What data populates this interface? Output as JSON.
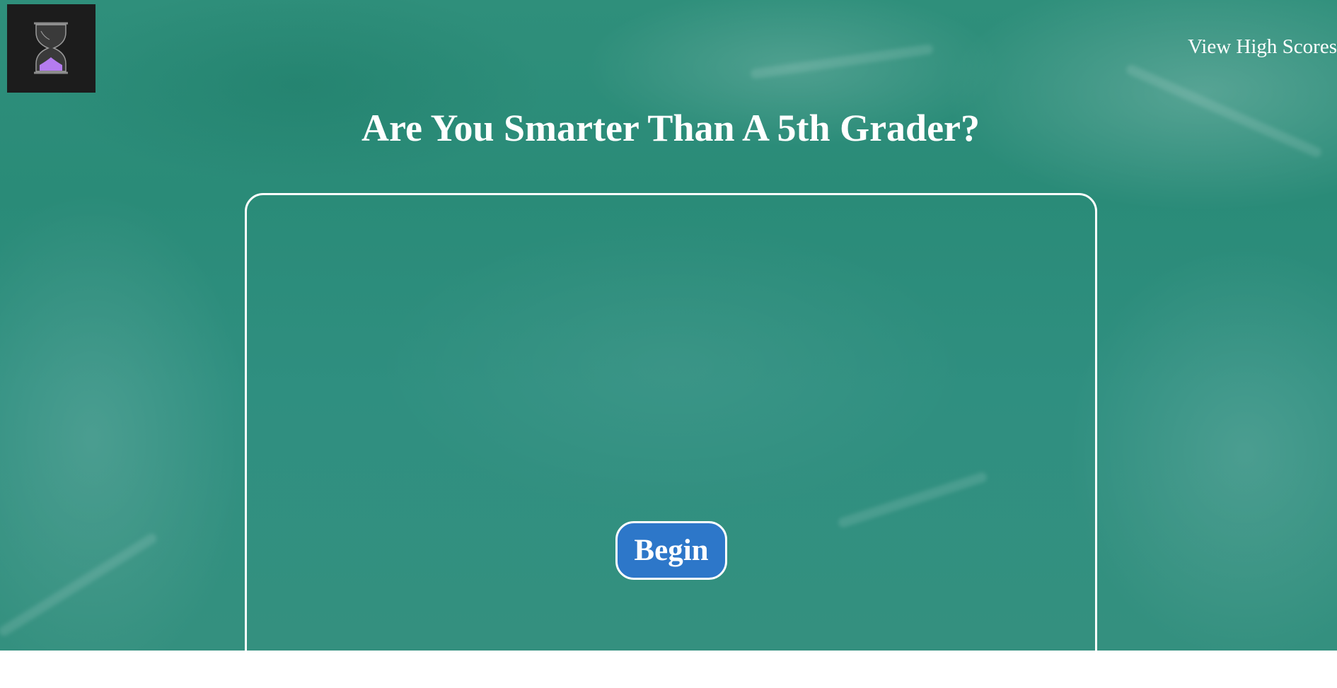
{
  "header": {
    "logo_icon": "hourglass-icon",
    "high_scores_link": "View High Scores"
  },
  "main": {
    "title": "Are You Smarter Than A 5th Grader?",
    "begin_button": "Begin"
  },
  "colors": {
    "chalkboard": "#2f8f7b",
    "button": "#2d77c9",
    "text": "#ffffff",
    "hourglass_sand": "#b57cf0"
  }
}
